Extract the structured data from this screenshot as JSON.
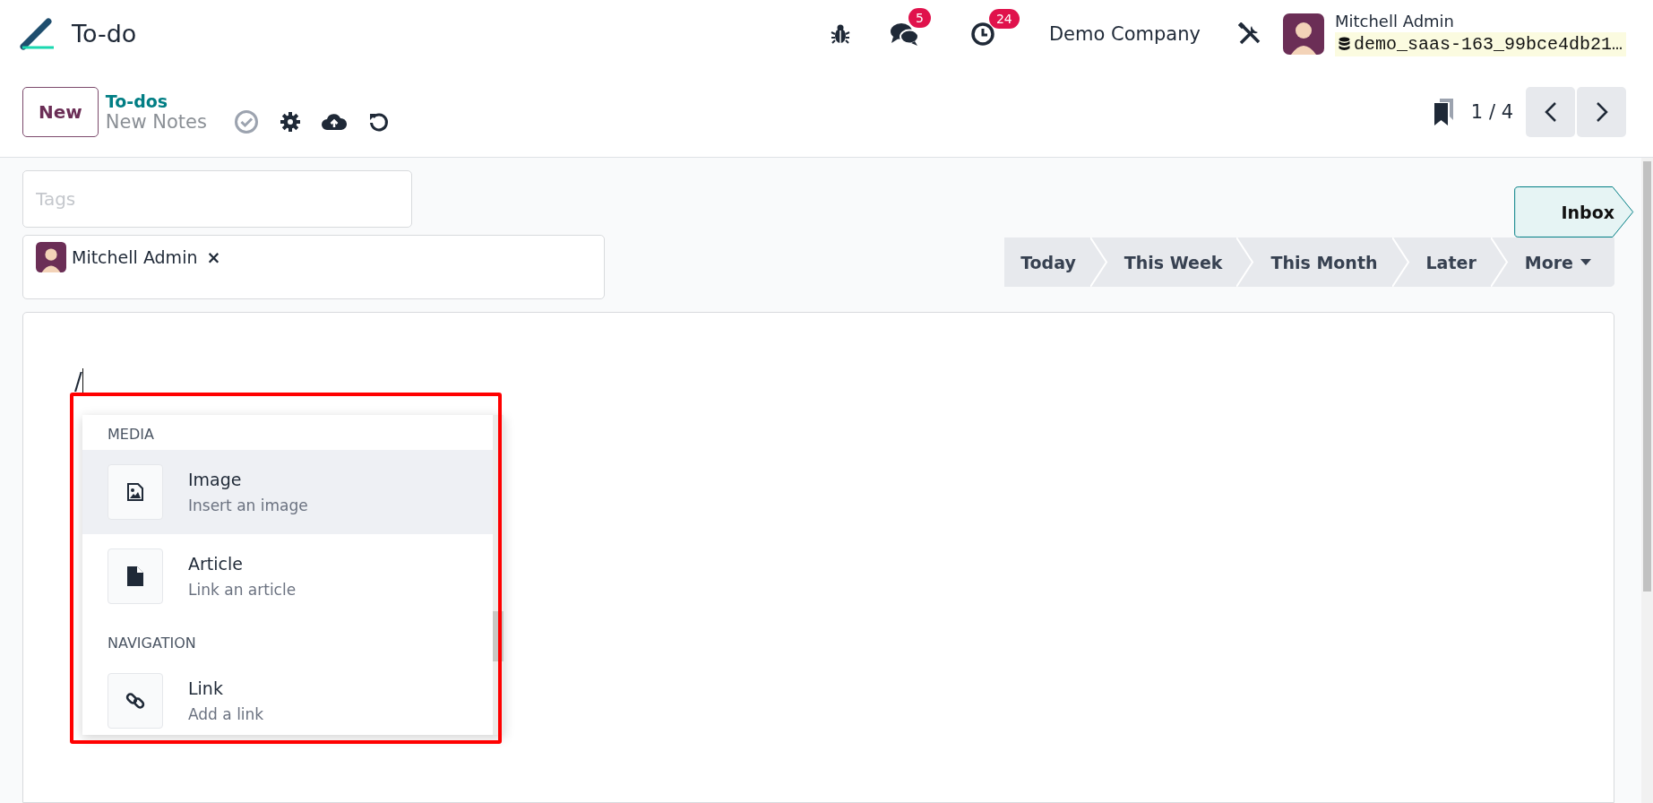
{
  "app": {
    "title": "To-do"
  },
  "systray": {
    "messages_count": "5",
    "activities_count": "24",
    "company": "Demo Company",
    "user": {
      "name": "Mitchell Admin",
      "database": "demo_saas-163_99bce4db21…"
    }
  },
  "control_panel": {
    "new_button": "New",
    "breadcrumb": {
      "parent": "To-dos",
      "current": "New Notes"
    },
    "pager": "1 / 4"
  },
  "form": {
    "tags": {
      "placeholder": "Tags"
    },
    "assignees": [
      {
        "name": "Mitchell Admin",
        "remove": "×"
      }
    ],
    "stages": [
      {
        "label": "Inbox",
        "selected": true
      },
      {
        "label": "Today",
        "selected": false
      },
      {
        "label": "This Week",
        "selected": false
      },
      {
        "label": "This Month",
        "selected": false
      },
      {
        "label": "Later",
        "selected": false
      }
    ],
    "more_button": "More"
  },
  "editor": {
    "text": "/"
  },
  "command_menu": {
    "groups": [
      {
        "title": "MEDIA",
        "items": [
          {
            "kind": "image",
            "title": "Image",
            "description": "Insert an image",
            "selected": true
          },
          {
            "kind": "article",
            "title": "Article",
            "description": "Link an article",
            "selected": false
          }
        ]
      },
      {
        "title": "NAVIGATION",
        "items": [
          {
            "kind": "link",
            "title": "Link",
            "description": "Add a link",
            "selected": false
          }
        ]
      }
    ]
  }
}
